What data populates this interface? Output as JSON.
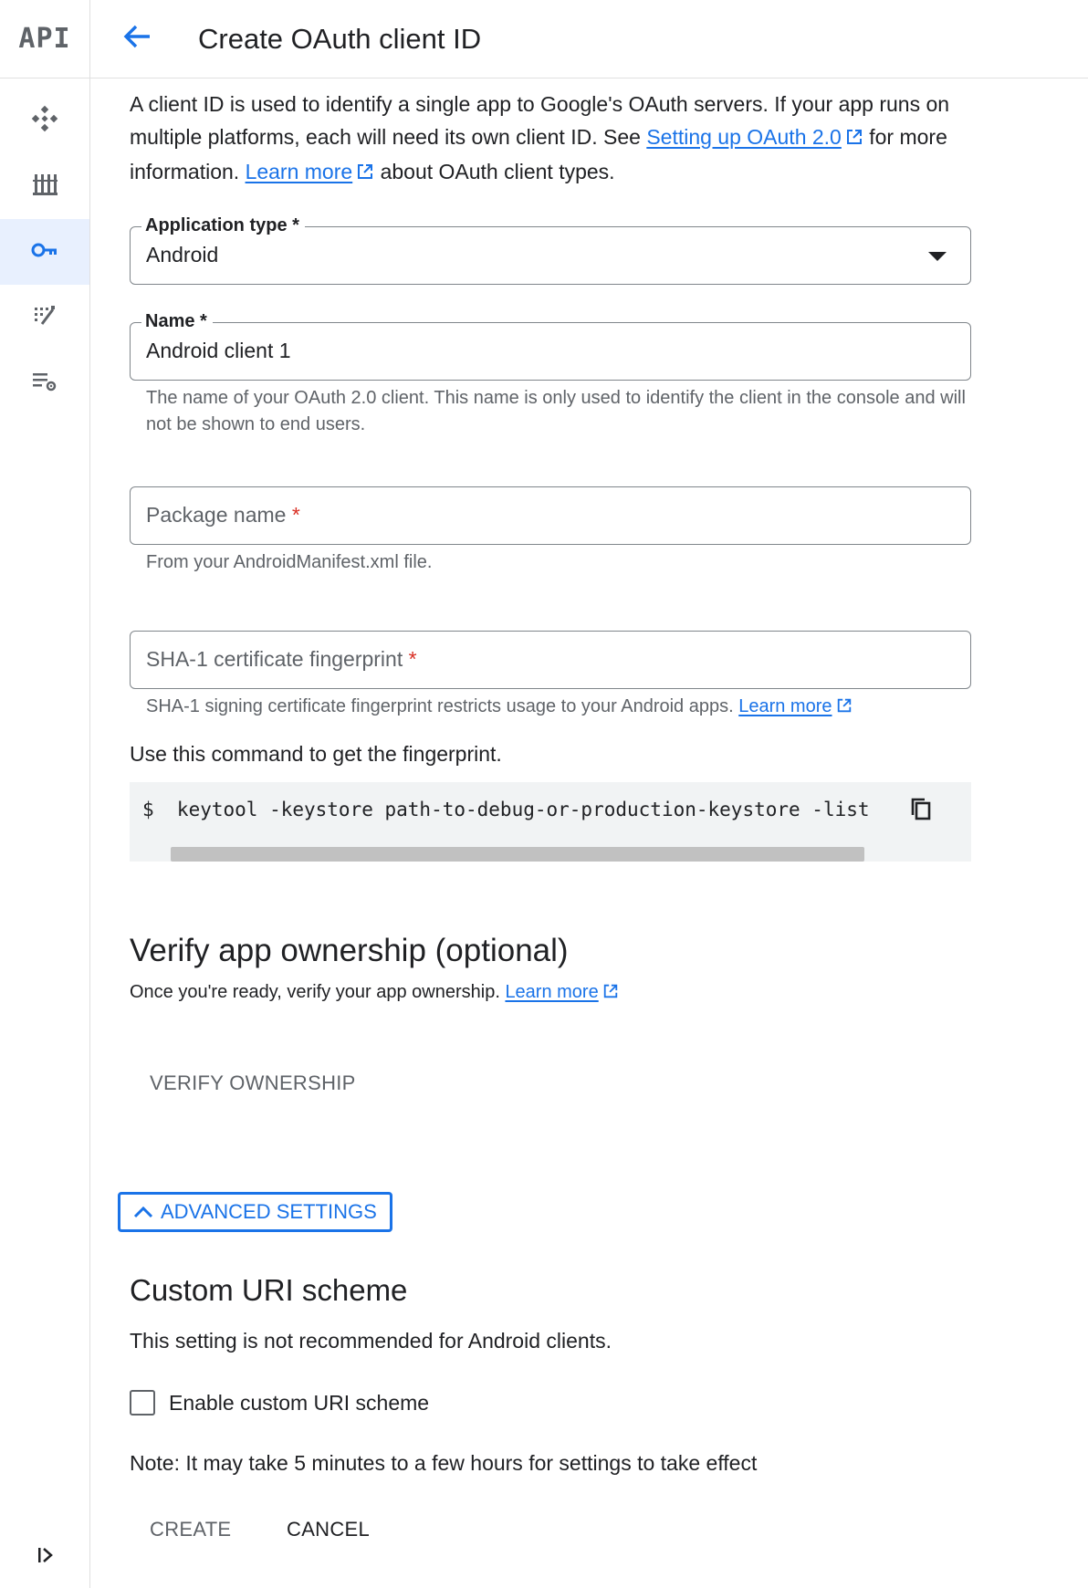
{
  "rail": {
    "logo": "API",
    "items": [
      {
        "icon": "dashboard-icon"
      },
      {
        "icon": "library-icon"
      },
      {
        "icon": "key-icon"
      },
      {
        "icon": "page-usage-icon"
      },
      {
        "icon": "settings-list-icon"
      }
    ],
    "expand_icon": "expand-rail-icon"
  },
  "header": {
    "title": "Create OAuth client ID"
  },
  "intro": {
    "text1": "A client ID is used to identify a single app to Google's OAuth servers. If your app runs on multiple platforms, each will need its own client ID. See ",
    "link1": "Setting up OAuth 2.0",
    "text2": " for more information. ",
    "link2": "Learn more",
    "text3": " about OAuth client types."
  },
  "application_type": {
    "label": "Application type *",
    "value": "Android"
  },
  "name_field": {
    "label": "Name *",
    "value": "Android client 1",
    "hint": "The name of your OAuth 2.0 client. This name is only used to identify the client in the console and will not be shown to end users."
  },
  "package_field": {
    "placeholder": "Package name",
    "required_mark": "*",
    "hint": "From your AndroidManifest.xml file."
  },
  "sha_field": {
    "placeholder": "SHA-1 certificate fingerprint",
    "required_mark": "*",
    "hint": "SHA-1 signing certificate fingerprint restricts usage to your Android apps. ",
    "hint_link": "Learn more"
  },
  "command": {
    "intro": "Use this command to get the fingerprint.",
    "text": "$  keytool -keystore path-to-debug-or-production-keystore -list"
  },
  "verify": {
    "title": "Verify app ownership (optional)",
    "text": "Once you're ready, verify your app ownership. ",
    "link": "Learn more",
    "button": "VERIFY OWNERSHIP"
  },
  "advanced": {
    "button": "ADVANCED SETTINGS"
  },
  "custom_uri": {
    "title": "Custom URI scheme",
    "text": "This setting is not recommended for Android clients.",
    "checkbox_label": "Enable custom URI scheme",
    "checked": false
  },
  "note": "Note: It may take 5 minutes to a few hours for settings to take effect",
  "actions": {
    "create": "CREATE",
    "cancel": "CANCEL"
  },
  "colors": {
    "accent": "#1a73e8",
    "required": "#d93025",
    "disabled_text": "#5f6368"
  }
}
